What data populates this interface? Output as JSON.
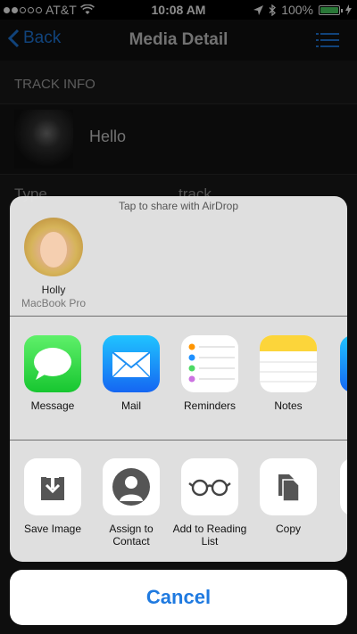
{
  "status_bar": {
    "carrier": "AT&T",
    "time": "10:08 AM",
    "battery": "100%",
    "battery_level": 1.0,
    "signal_bars_filled": 2
  },
  "nav": {
    "back_label": "Back",
    "title": "Media Detail",
    "accent_color": "#1f7ae0"
  },
  "detail": {
    "section_label": "TRACK INFO",
    "track_title": "Hello",
    "type_label": "Type",
    "type_value": "track"
  },
  "share_sheet": {
    "airdrop_title": "Tap to share with AirDrop",
    "contact": {
      "name": "Holly",
      "device": "MacBook Pro"
    },
    "apps": [
      {
        "label": "Message",
        "icon": "message-icon"
      },
      {
        "label": "Mail",
        "icon": "mail-icon"
      },
      {
        "label": "Reminders",
        "icon": "reminders-icon"
      },
      {
        "label": "Notes",
        "icon": "notes-icon"
      }
    ],
    "actions": [
      {
        "label": "Save Image",
        "icon": "save-image-icon"
      },
      {
        "label": "Assign to Contact",
        "icon": "assign-contact-icon"
      },
      {
        "label": "Add to Reading List",
        "icon": "reading-list-icon"
      },
      {
        "label": "Copy",
        "icon": "copy-icon"
      }
    ],
    "cancel_label": "Cancel"
  }
}
